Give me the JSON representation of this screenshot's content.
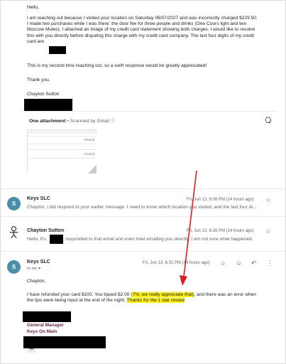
{
  "first_message": {
    "greeting": "Hello,",
    "paragraph_lines": [
      "I am reaching out because I visited your location on Saturday 06/07/2027 and was incorrectly charged $229.50.",
      "I made two purchases while I was there: the door fee for three people and drinks (One Coors light and two",
      "Moscow Mules). I attached an image of my credit card statement showing both charges. I would like to resolve",
      "this with you directly before disputing this charge with my credit card company. The last four digits of my credit",
      "card are"
    ],
    "second_time": "This is my second time reaching out, so a swift response would be greatly appreciated!",
    "closing": "Thank you,",
    "signature_name": "Chayton Sutton"
  },
  "attachment": {
    "heading": "One attachment",
    "separator": " • ",
    "scanned": "Scanned by Gmail",
    "info_glyph": "ⓘ",
    "thumbnail_labels": [
      "Food &",
      "Food &"
    ],
    "drive_icon": "add-to-drive-icon"
  },
  "messages": [
    {
      "avatar_letter": "S",
      "sender": "Keys SLC",
      "date": "Fri, Jun 13, 6:08 PM (14 hours ago)",
      "snippet": "Chayton, I did respond to your earlier message. I need to know which location you visited, and the last four di..."
    },
    {
      "avatar": "stick-figure-avatar",
      "sender": "Chayton Sutton",
      "date": "Fri, Jun 13, 6:26 PM (14 hours ago)",
      "snippet_before": "Hello, It's",
      "snippet_after": "responded to that email and even tried emailing you directly. I am not sure what happened."
    }
  ],
  "open_message": {
    "avatar_letter": "S",
    "sender": "Keys SLC",
    "date": "Fri, Jun 13, 6:31 PM (14 hours ago)",
    "to": "to me",
    "greeting": "Chayton,",
    "line1_a": "I have refunded your card $200. You tipped $2.00 (",
    "line1_hl": "7%, we really appreciate that)",
    "line1_b": ", and there was an error when",
    "line2_a": "the tips were being input at the end of the night. ",
    "line2_hl": "Thanks for the 1 star review",
    "sig_role": "General Manager",
    "sig_company": "Keys On Main",
    "trim_glyph": "•••"
  },
  "icons": {
    "star": "☆",
    "reply": "↶",
    "more": "⋮",
    "emoji": "☺",
    "caret": "▾"
  },
  "colors": {
    "avatar_bg": "#4a8ea8",
    "highlight": "#fff200",
    "arrow": "#e31b1b",
    "signature": "#741b47"
  }
}
